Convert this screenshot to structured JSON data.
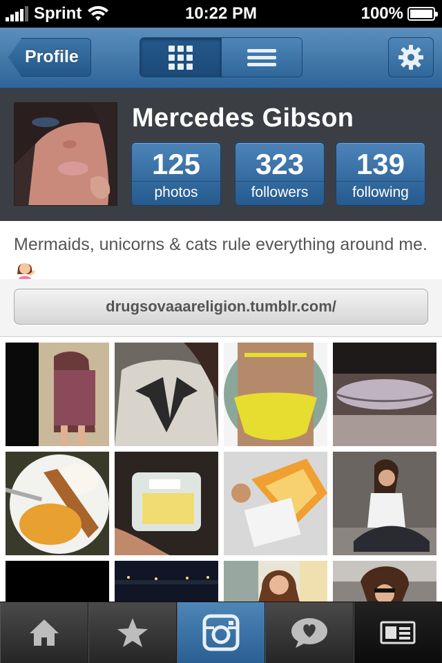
{
  "status_bar": {
    "carrier": "Sprint",
    "time": "10:22 PM",
    "battery": "100%",
    "battery_level": 1.0,
    "icons": [
      "signal-bars-icon",
      "wifi-icon",
      "battery-icon"
    ]
  },
  "nav": {
    "back_label": "Profile",
    "view_toggle": [
      "grid-view-icon",
      "list-view-icon"
    ],
    "active_view": "grid",
    "settings_icon": "gear-icon"
  },
  "profile": {
    "name": "Mercedes Gibson",
    "stats": [
      {
        "value": "125",
        "label": "photos"
      },
      {
        "value": "323",
        "label": "followers"
      },
      {
        "value": "139",
        "label": "following"
      }
    ],
    "bio": "Mermaids, unicorns & cats rule everything around me.",
    "website": "drugsovaaareligion.tumblr.com/"
  },
  "tabs": [
    {
      "icon": "home-icon"
    },
    {
      "icon": "star-icon"
    },
    {
      "icon": "camera-icon",
      "active": true
    },
    {
      "icon": "speech-heart-icon"
    },
    {
      "icon": "profile-card-icon"
    }
  ],
  "colors": {
    "nav_blue": "#2e6598",
    "stat_blue": "#245a8e",
    "profile_bg": "#3b3f45"
  }
}
